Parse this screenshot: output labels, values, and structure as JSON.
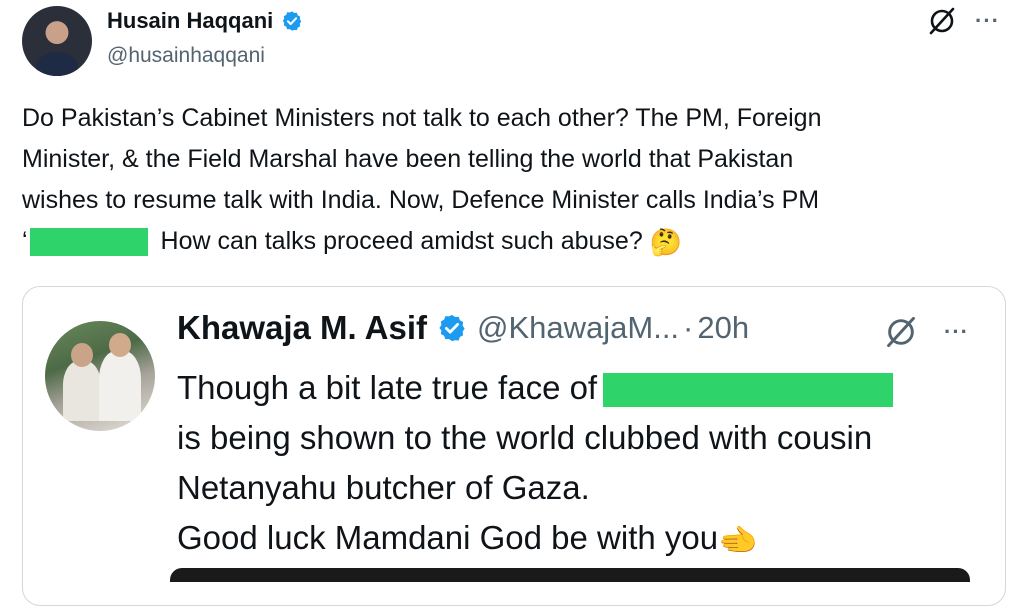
{
  "tweet": {
    "author_name": "Husain Haqqani",
    "author_handle": "@husainhaqqani",
    "more_label": "···",
    "lines": [
      "Do Pakistan’s Cabinet Ministers not talk to each other? The PM, Foreign",
      "Minister, & the Field Marshal have been telling the world that Pakistan",
      "wishes to resume talk with India. Now, Defence Minister calls India’s PM",
      "How can talks proceed amidst such abuse?"
    ],
    "quote_mark": "‘",
    "emoji": "🤔"
  },
  "quote": {
    "author_name": "Khawaja M. Asif",
    "author_handle": "@KhawajaM...",
    "separator": "·",
    "time": "20h",
    "more_label": "···",
    "line1": "Though a bit late true face of",
    "line2": "is being shown to the world clubbed with cousin",
    "line3": "Netanyahu butcher of Gaza.",
    "line4": "Good luck Mamdani God be with you",
    "emoji": "🫲"
  },
  "colors": {
    "verified": "#1d9bf0",
    "redaction": "#2ed36a",
    "secondary_text": "#536471"
  },
  "icons": [
    "verified-badge-icon",
    "grok-icon",
    "more-icon"
  ]
}
